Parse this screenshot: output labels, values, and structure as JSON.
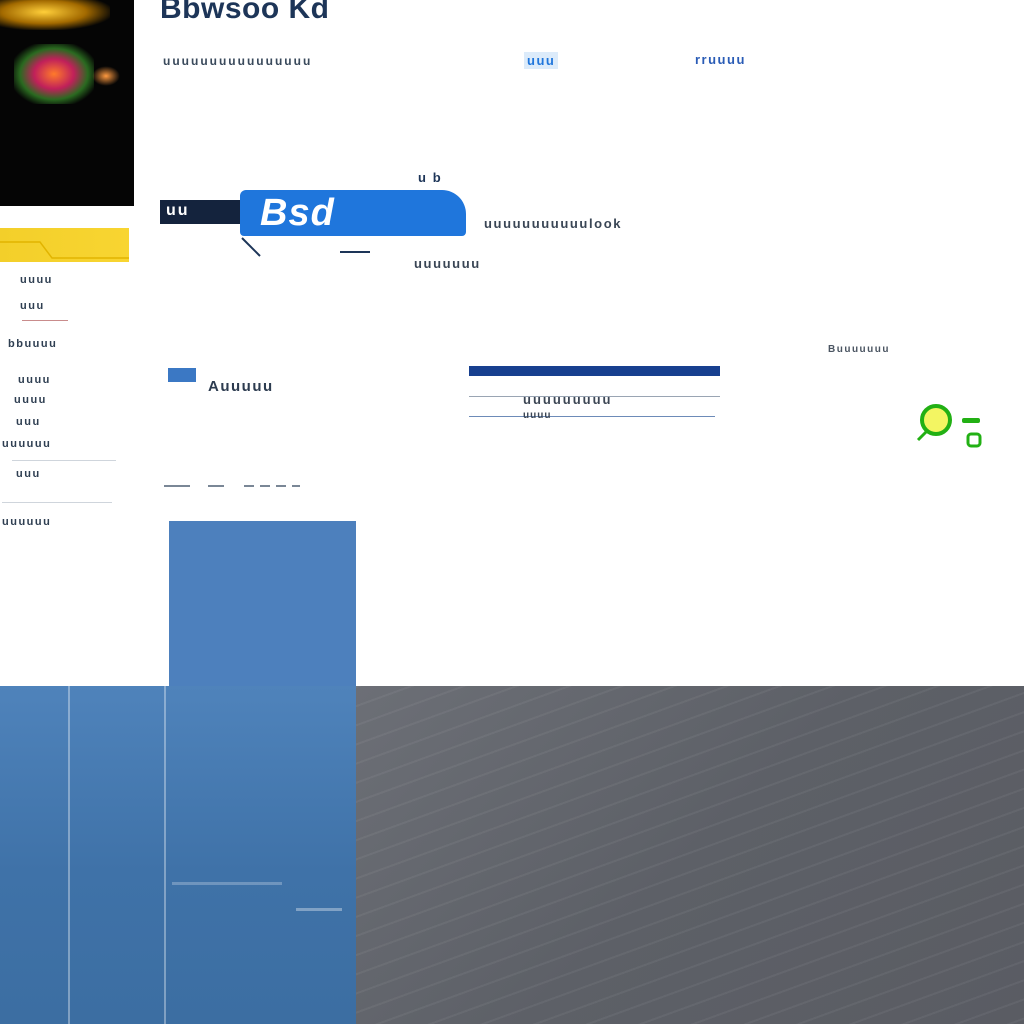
{
  "header": {
    "title": "Bbwsoo Kd",
    "subtitle": "uuuuuuuuuuuuuuuu",
    "link_short": "uuu",
    "link_long": "rruuuu"
  },
  "sidebar": {
    "items": [
      {
        "label": "uuuu"
      },
      {
        "label": "uuu"
      },
      {
        "label": "bbuuuu"
      },
      {
        "label": "uuuu"
      },
      {
        "label": "uuuu"
      },
      {
        "label": "uuu"
      },
      {
        "label": "uuuuuu"
      },
      {
        "label": "uuu"
      },
      {
        "label": "uuuuuu"
      }
    ]
  },
  "hero": {
    "kicker": "u b",
    "logo_left": "uu",
    "logo_text": "Bsd",
    "description": "uuuuuuuuuuulook",
    "caption": "uuuuuuu"
  },
  "section": {
    "label": "Auuuuu"
  },
  "search": {
    "result_label": "uuuuuuuuu",
    "result_sub": "uuuu"
  },
  "right_note": "Buuuuuuu",
  "colors": {
    "accent": "#1f76dc",
    "brand_dark": "#173f8f",
    "sidebar_highlight": "#f3cf2a",
    "status": "#22b014"
  }
}
